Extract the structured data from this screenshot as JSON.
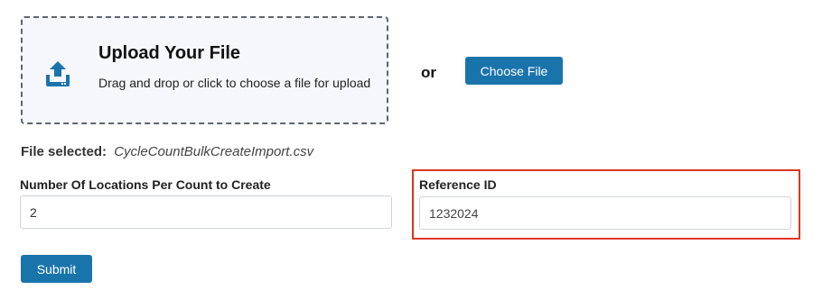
{
  "upload": {
    "title": "Upload Your File",
    "subtitle": "Drag and drop or click to choose a file for upload",
    "icon": "upload-icon"
  },
  "or_text": "or",
  "choose_file_label": "Choose File",
  "file_selected": {
    "label": "File selected:",
    "filename": "CycleCountBulkCreateImport.csv"
  },
  "fields": {
    "locations": {
      "label": "Number Of Locations Per Count to Create",
      "value": "2"
    },
    "reference": {
      "label": "Reference ID",
      "value": "1232024"
    }
  },
  "submit_label": "Submit",
  "colors": {
    "button": "#1a74ac",
    "highlight": "#e0361c",
    "dropzone_bg": "#f6f7fc"
  }
}
